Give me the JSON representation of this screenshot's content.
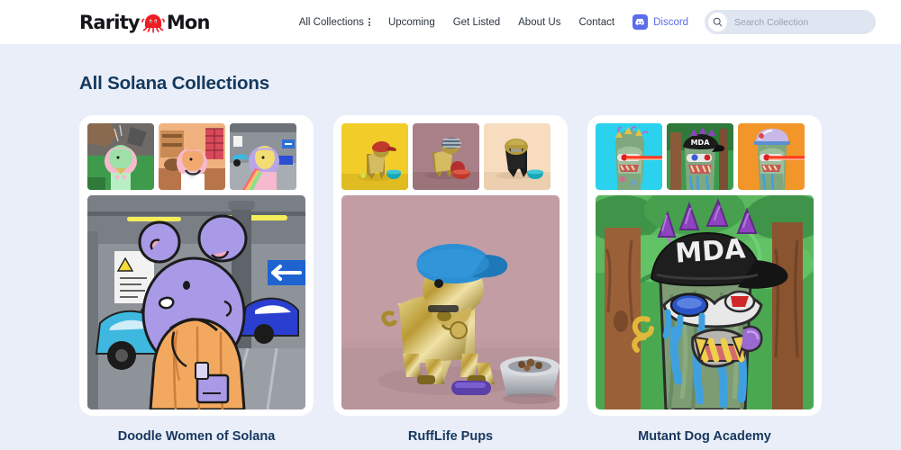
{
  "brand": {
    "name_part1": "Rarity",
    "name_part2": "Mon",
    "mascot_icon": "octopus-icon",
    "mascot_color": "#ee1d24"
  },
  "nav": {
    "items": [
      {
        "label": "All Collections",
        "has_menu": true
      },
      {
        "label": "Upcoming",
        "has_menu": false
      },
      {
        "label": "Get Listed",
        "has_menu": false
      },
      {
        "label": "About Us",
        "has_menu": false
      },
      {
        "label": "Contact",
        "has_menu": false
      }
    ],
    "discord": {
      "label": "Discord",
      "icon": "discord-icon",
      "color": "#5b6ceb"
    }
  },
  "search": {
    "placeholder": "Search Collection",
    "value": "",
    "icon": "search-icon"
  },
  "main": {
    "heading": "All Solana Collections",
    "collections": [
      {
        "title": "Doodle Women of Solana",
        "hero_alt": "doodle-woman-purple-hair-parking-garage",
        "thumbs": [
          "doodle-green-face-pink-hair-cave",
          "doodle-orange-face-pink-hair-workshop",
          "doodle-yellow-face-purple-hair-garage"
        ]
      },
      {
        "title": "RuffLife Pups",
        "hero_alt": "gold-dog-blue-cap-pink-backdrop",
        "thumbs": [
          "gold-dog-red-cap-yellow-backdrop",
          "gold-dog-striped-cap-mauve-backdrop",
          "gold-dog-black-shirt-peach-backdrop"
        ]
      },
      {
        "title": "Mutant Dog Academy",
        "hero_alt": "mutant-ape-mda-cap-forest",
        "thumbs": [
          "mutant-laser-eyes-cyan-backdrop",
          "mutant-mda-cap-forest-backdrop",
          "mutant-helmet-orange-backdrop"
        ]
      }
    ]
  },
  "theme": {
    "page_background": "#e9eef8",
    "header_background": "#ffffff",
    "card_background": "#ffffff",
    "heading_color": "#14395e",
    "accent_color": "#5b6ceb"
  }
}
